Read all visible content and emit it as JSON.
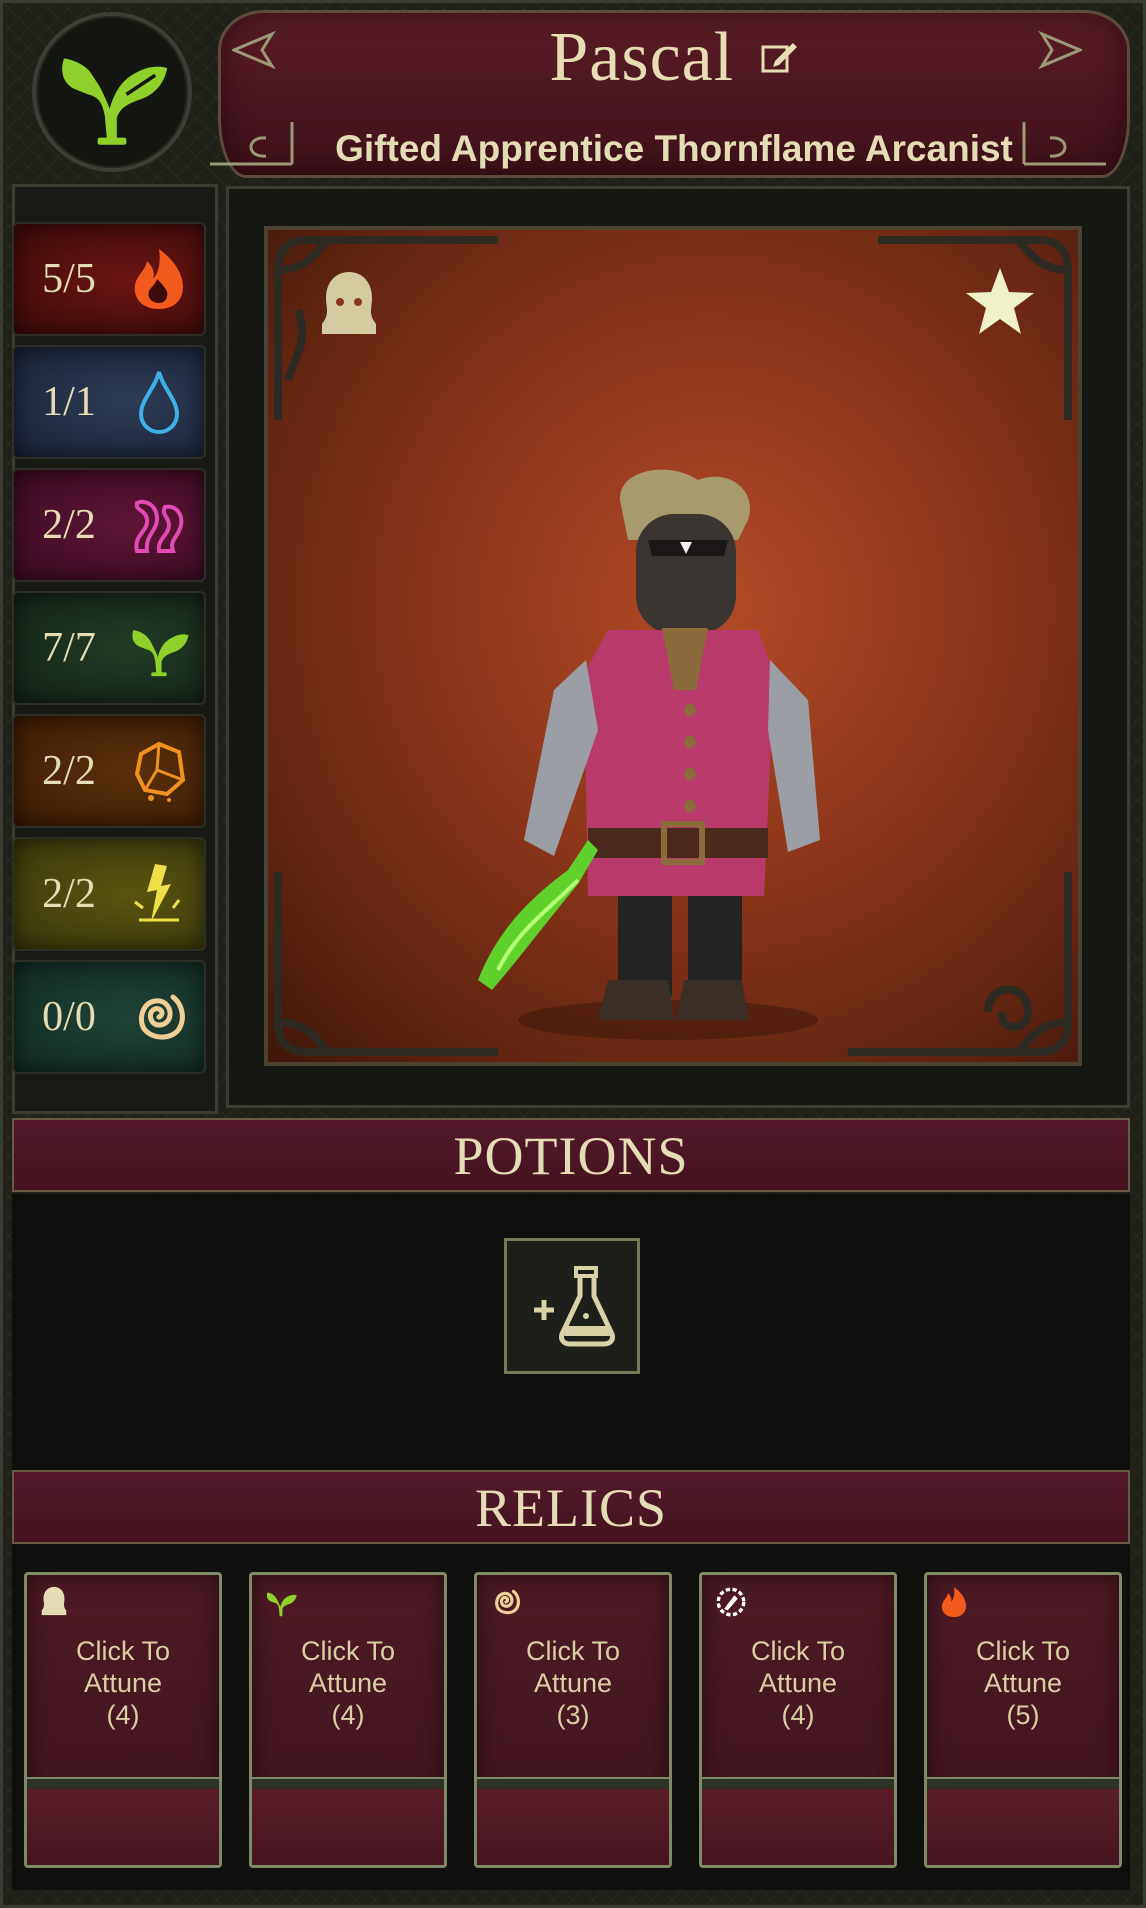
{
  "character": {
    "name": "Pascal",
    "title": "Gifted Apprentice Thornflame Arcanist",
    "emblem_icon": "sprout-icon",
    "edit_icon": "edit-icon",
    "favorite_icon": "star-icon",
    "class_icon": "hooded-figure-icon"
  },
  "elements": [
    {
      "id": "fire",
      "value": "5/5",
      "icon": "flame-icon",
      "color": "#f35a1e",
      "bg": "#5a1010"
    },
    {
      "id": "water",
      "value": "1/1",
      "icon": "water-drop-icon",
      "color": "#3fb0e6",
      "bg": "#1d2a40"
    },
    {
      "id": "aether",
      "value": "2/2",
      "icon": "tentacle-icon",
      "color": "#e24bb5",
      "bg": "#4a1030"
    },
    {
      "id": "nature",
      "value": "7/7",
      "icon": "sprout-icon",
      "color": "#8fd12a",
      "bg": "#18301c"
    },
    {
      "id": "earth",
      "value": "2/2",
      "icon": "rock-icon",
      "color": "#f0901f",
      "bg": "#4a2608"
    },
    {
      "id": "lightning",
      "value": "2/2",
      "icon": "lightning-icon",
      "color": "#efe04a",
      "bg": "#4a4a0c"
    },
    {
      "id": "wind",
      "value": "0/0",
      "icon": "swirl-icon",
      "color": "#f0cf96",
      "bg": "#17352c"
    }
  ],
  "sections": {
    "potions": "POTIONS",
    "relics": "RELICS"
  },
  "potions": {
    "add_icon": "add-potion-icon"
  },
  "relics": [
    {
      "icon": "hooded-figure-icon",
      "line1": "Click To",
      "line2": "Attune",
      "cost": "(4)",
      "color": "#e4dcb4"
    },
    {
      "icon": "sprout-icon",
      "line1": "Click To",
      "line2": "Attune",
      "cost": "(4)",
      "color": "#8fd12a"
    },
    {
      "icon": "swirl-icon",
      "line1": "Click To",
      "line2": "Attune",
      "cost": "(3)",
      "color": "#f0cf96"
    },
    {
      "icon": "gear-compass-icon",
      "line1": "Click To",
      "line2": "Attune",
      "cost": "(4)",
      "color": "#ffffff"
    },
    {
      "icon": "flame-icon",
      "line1": "Click To",
      "line2": "Attune",
      "cost": "(5)",
      "color": "#f35a1e"
    }
  ]
}
